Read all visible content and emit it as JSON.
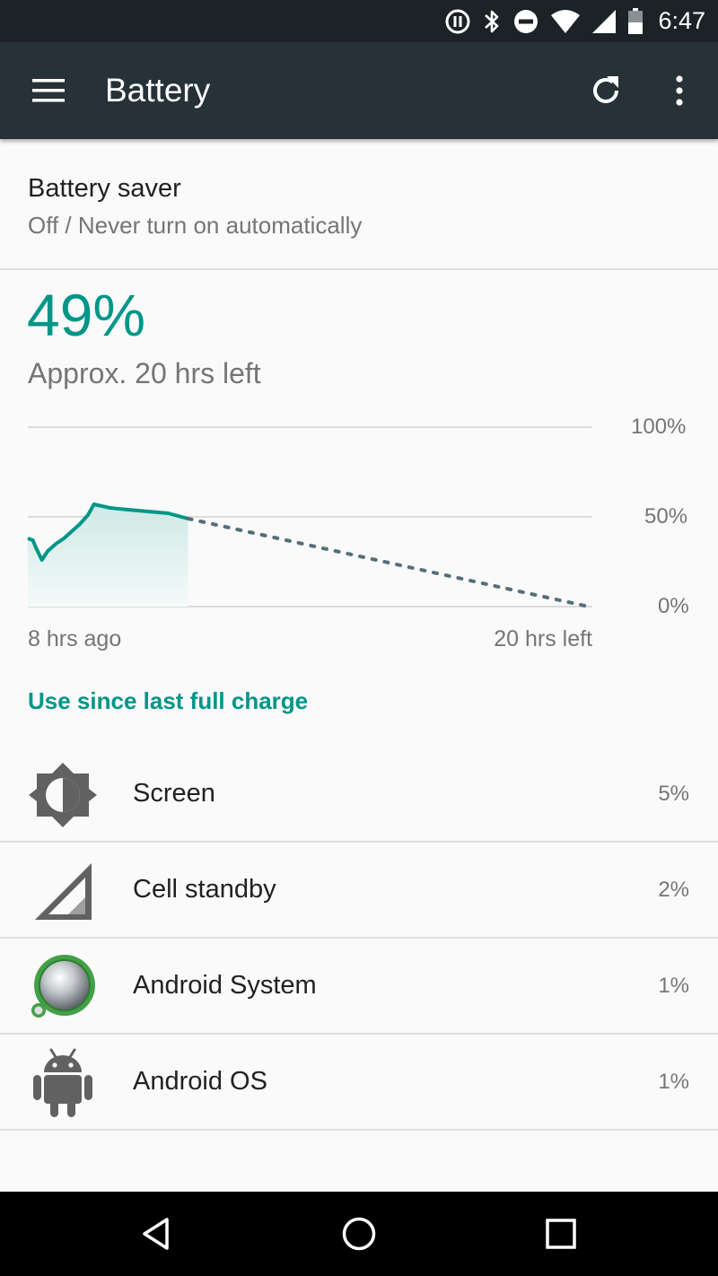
{
  "status_bar": {
    "time": "6:47",
    "icons": [
      "pause-circle-icon",
      "bluetooth-icon",
      "do-not-disturb-icon",
      "wifi-icon",
      "cell-signal-icon",
      "battery-icon"
    ]
  },
  "app_bar": {
    "title": "Battery",
    "icons": [
      "menu-icon",
      "refresh-icon",
      "more-vert-icon"
    ]
  },
  "battery_saver": {
    "title": "Battery saver",
    "subtitle": "Off / Never turn on automatically"
  },
  "battery": {
    "percent": "49%",
    "estimate": "Approx. 20 hrs left"
  },
  "chart_data": {
    "type": "line",
    "y_ticks": [
      "100%",
      "50%",
      "0%"
    ],
    "ylim": [
      0,
      100
    ],
    "x_labels": {
      "start": "8 hrs ago",
      "end": "20 hrs left"
    },
    "history_hours": [
      -8,
      -7.75,
      -7.6,
      -7.3,
      -7.0,
      -6.6,
      -6.2,
      -5.8,
      -5.4,
      -5.0,
      -4.7,
      -4.3,
      -3.9,
      -3.0,
      -2.0,
      -1.0,
      0
    ],
    "history_percent": [
      38,
      37,
      33,
      26,
      31,
      35,
      38,
      42,
      46,
      51,
      57,
      56,
      55,
      54,
      53,
      52,
      49
    ],
    "projection_hours": [
      0,
      20
    ],
    "projection_percent": [
      49,
      0
    ],
    "colors": {
      "line": "#009688",
      "fill": "#e0f2f1",
      "projection": "#546e7a",
      "grid": "#dcdcdc"
    }
  },
  "usage": {
    "header": "Use since last full charge",
    "items": [
      {
        "name": "Screen",
        "percent": "5%",
        "icon": "brightness-icon"
      },
      {
        "name": "Cell standby",
        "percent": "2%",
        "icon": "cell-signal-icon"
      },
      {
        "name": "Android System",
        "percent": "1%",
        "icon": "android-system-icon"
      },
      {
        "name": "Android OS",
        "percent": "1%",
        "icon": "android-robot-icon"
      }
    ]
  },
  "nav_bar": {
    "icons": [
      "back-icon",
      "home-icon",
      "recents-icon"
    ]
  },
  "colors": {
    "accent": "#009688",
    "app_bar": "#263238",
    "status_bar": "#1c2327"
  }
}
